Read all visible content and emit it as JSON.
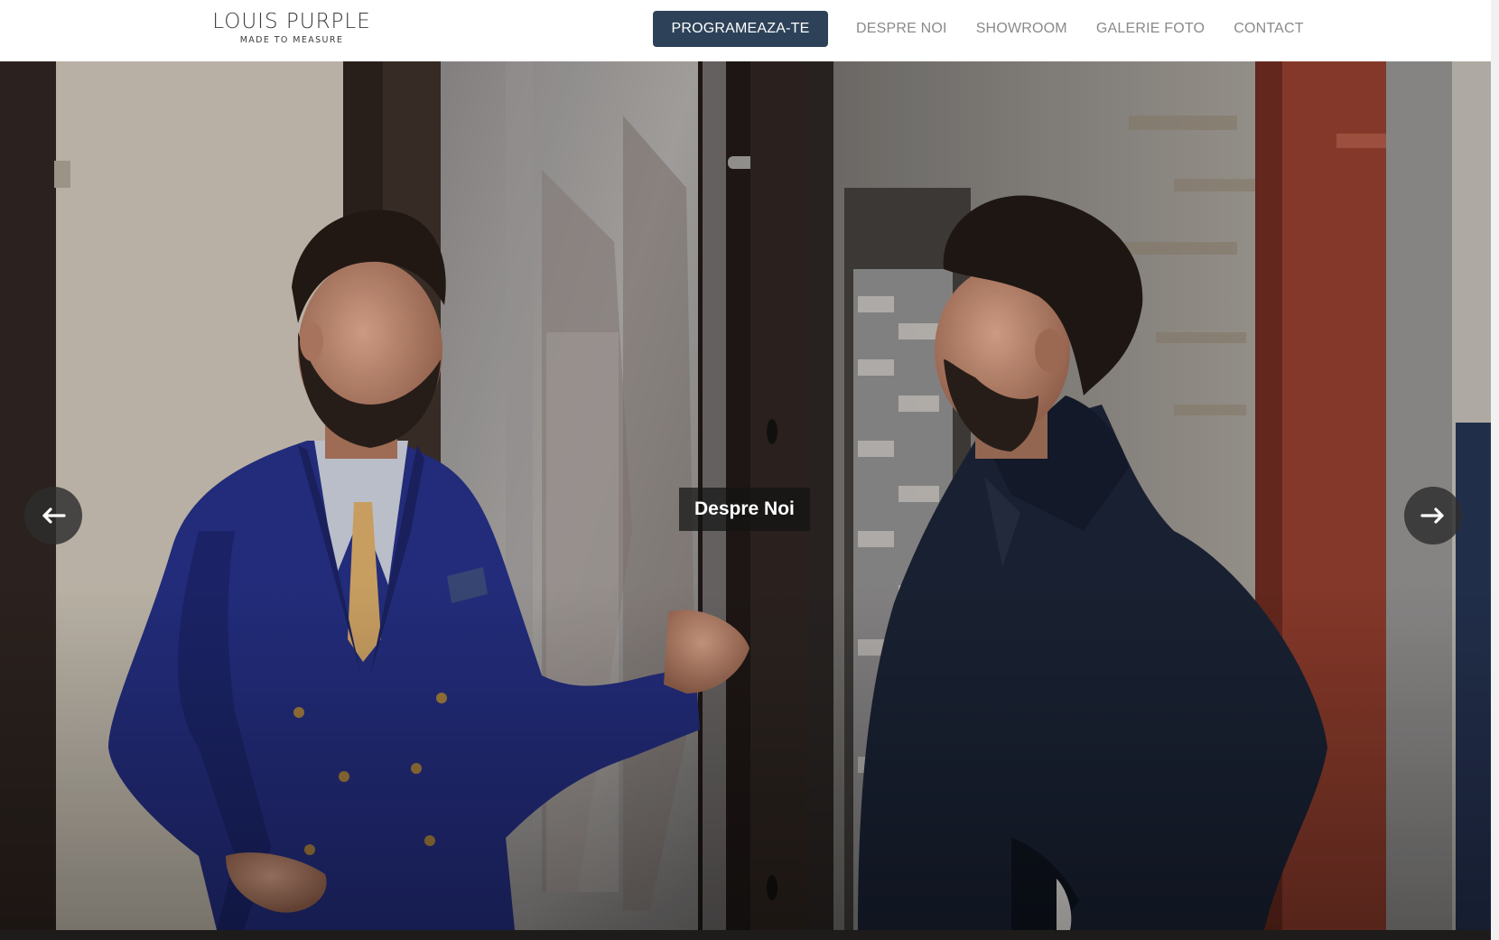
{
  "header": {
    "logo": {
      "name": "LOUIS PURPLE",
      "tagline": "MADE TO MEASURE"
    },
    "cta_label": "PROGRAMEAZA-TE",
    "nav": [
      {
        "label": "DESPRE NOI"
      },
      {
        "label": "SHOWROOM"
      },
      {
        "label": "GALERIE FOTO"
      },
      {
        "label": "CONTACT"
      }
    ]
  },
  "hero": {
    "caption": "Despre Noi",
    "prev_icon": "arrow-left-icon",
    "next_icon": "arrow-right-icon"
  },
  "colors": {
    "cta_background": "#2d4258",
    "nav_text": "#8a8a8a",
    "suit_blue": "#24307e",
    "coat_navy": "#1b2335"
  }
}
